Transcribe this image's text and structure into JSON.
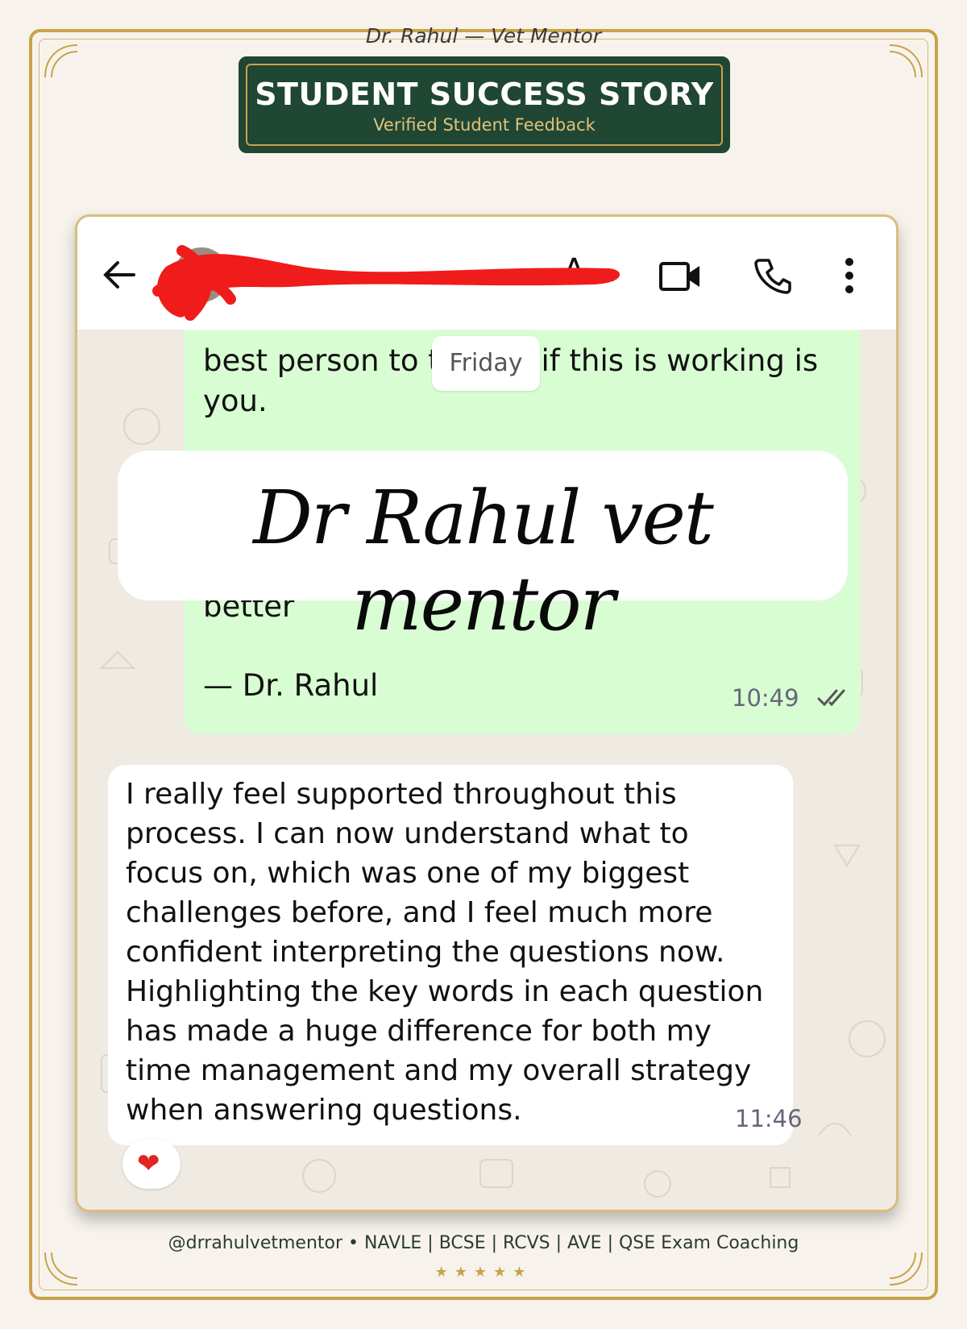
{
  "caption": "Dr. Rahul — Vet Mentor",
  "banner": {
    "title": "STUDENT SUCCESS STORY",
    "subtitle": "Verified Student Feedback"
  },
  "chat": {
    "header": {
      "contact_name": "A…",
      "icons": [
        "back-arrow-icon",
        "avatar",
        "video-call-icon",
        "voice-call-icon",
        "more-options-icon"
      ]
    },
    "outgoing": {
      "line1": "best person to tell me if this is working is you.",
      "date_chip": "Friday",
      "line2": "better",
      "signature": "— Dr. Rahul",
      "time": "10:49"
    },
    "overlay_text": "Dr Rahul vet mentor",
    "incoming": {
      "text": "I really feel supported throughout this process. I can now understand what to focus on, which was one of my biggest challenges before, and I feel much more confident interpreting the questions now. Highlighting the key words in each question has made a huge difference for both my time management and my overall strategy when answering questions.",
      "time": "11:46",
      "reaction": "❤"
    }
  },
  "footer": {
    "text": "@drrahulvetmentor • NAVLE | BCSE | RCVS | AVE | QSE Exam Coaching",
    "stars": "★★★★★"
  },
  "colors": {
    "gold": "#c9a24a",
    "banner_green": "#1f4733",
    "outgoing_bubble": "#d9fdd3",
    "incoming_bubble": "#ffffff",
    "chat_background": "#efeae2"
  }
}
